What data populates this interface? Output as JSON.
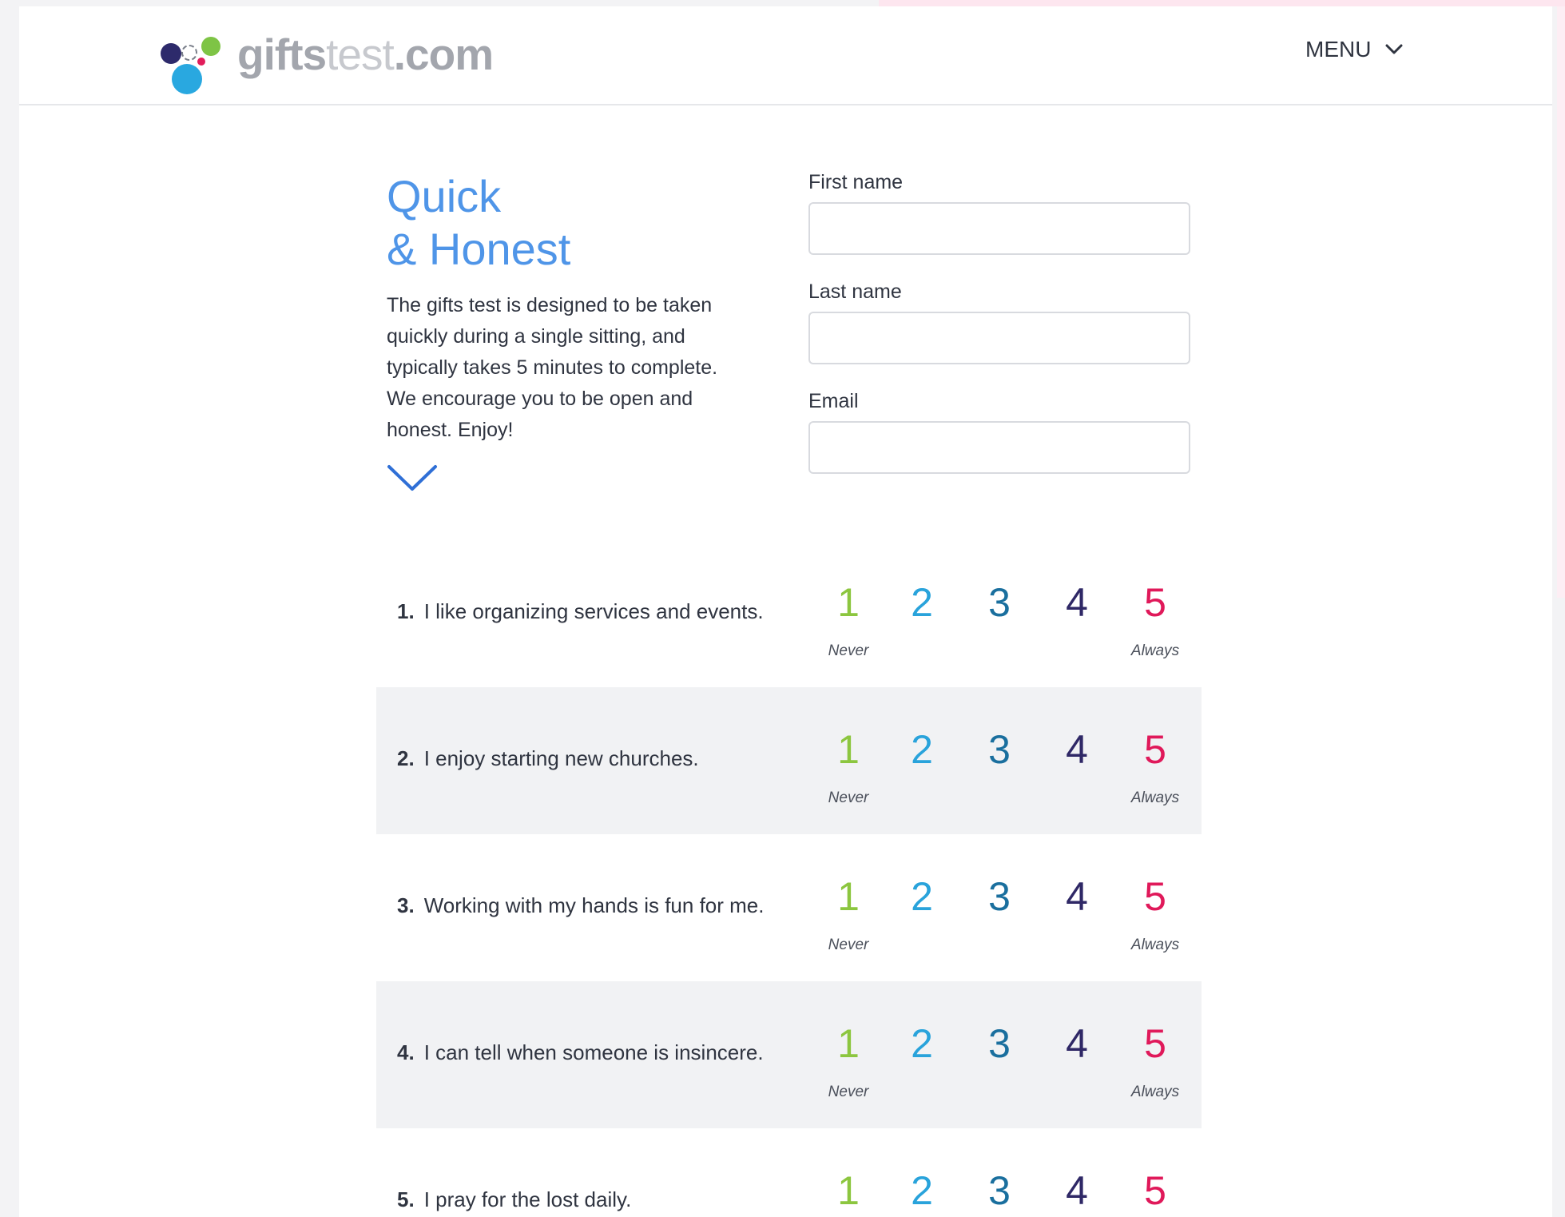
{
  "header": {
    "logo": {
      "part1": "gifts",
      "part2": "test",
      "part3": ".com"
    },
    "menu_label": "MENU"
  },
  "intro": {
    "title_line1": "Quick",
    "title_line2": "& Honest",
    "description": "The gifts test is designed to be taken quickly during a single sitting, and typically takes 5 minutes to complete. We encourage you to be open and honest. Enjoy!"
  },
  "form": {
    "first_name": {
      "label": "First name",
      "value": ""
    },
    "last_name": {
      "label": "Last name",
      "value": ""
    },
    "email": {
      "label": "Email",
      "value": ""
    }
  },
  "scale": {
    "options": [
      "1",
      "2",
      "3",
      "4",
      "5"
    ],
    "colors": [
      "#8cc63f",
      "#29a3db",
      "#1a6f9e",
      "#2f2866",
      "#e0195a"
    ],
    "low_label": "Never",
    "high_label": "Always"
  },
  "questions": [
    {
      "number": "1.",
      "text": "I like organizing services and events."
    },
    {
      "number": "2.",
      "text": "I enjoy starting new churches."
    },
    {
      "number": "3.",
      "text": "Working with my hands is fun for me."
    },
    {
      "number": "4.",
      "text": "I can tell when someone is insincere."
    },
    {
      "number": "5.",
      "text": "I pray for the lost daily."
    }
  ],
  "colors": {
    "accent": "#4f95e8",
    "alt_row": "#f1f2f4"
  }
}
